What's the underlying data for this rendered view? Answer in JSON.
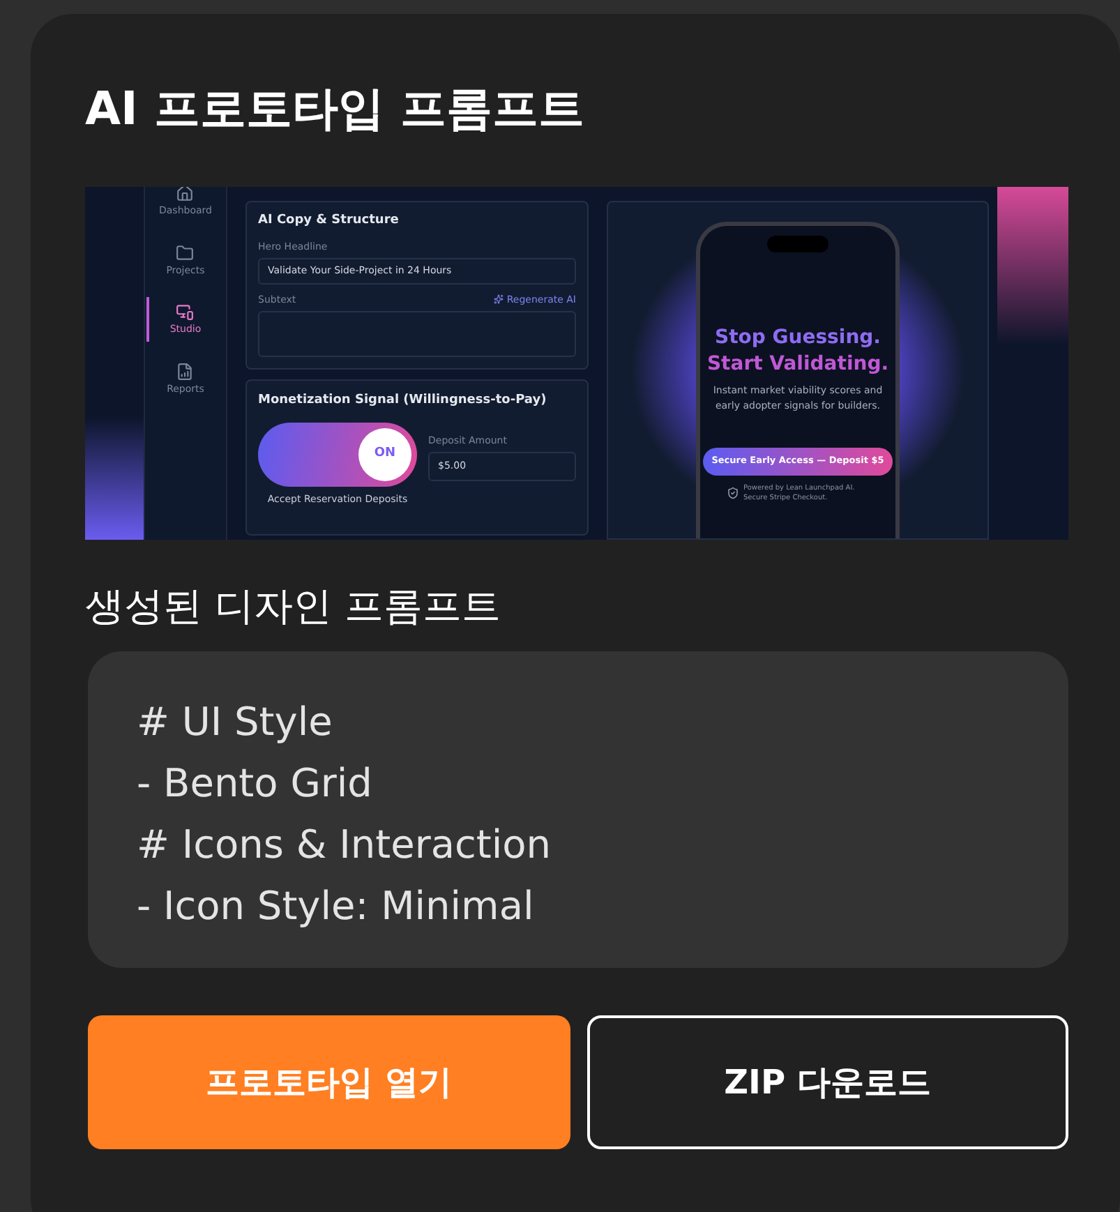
{
  "title": "AI 프로토타입 프롬프트",
  "preview": {
    "sidebar": [
      {
        "label": "Dashboard",
        "kind": "home",
        "selected": false
      },
      {
        "label": "Projects",
        "kind": "folder",
        "selected": false
      },
      {
        "label": "Studio",
        "kind": "devices",
        "selected": true
      },
      {
        "label": "Reports",
        "kind": "report",
        "selected": false
      }
    ],
    "copy_card": {
      "title": "AI Copy & Structure",
      "hero_label": "Hero Headline",
      "hero_value": "Validate Your Side-Project in 24 Hours",
      "subtext_label": "Subtext",
      "regenerate": "Regenerate AI"
    },
    "monetization": {
      "title": "Monetization Signal (Willingness-to-Pay)",
      "toggle": {
        "label": "ON",
        "on": true
      },
      "toggle_caption": "Accept Reservation Deposits",
      "deposit_label": "Deposit Amount",
      "deposit_value": "$5.00"
    },
    "phone": {
      "headline_1": "Stop Guessing.",
      "headline_2": "Start Validating.",
      "body": "Instant market viability scores and early adopter signals for builders.",
      "cta": "Secure Early Access — Deposit $5",
      "footer": "Powered by Lean Launchpad AI. Secure Stripe Checkout."
    }
  },
  "prompt_label": "생성된 디자인 프롬프트",
  "prompt_lines": [
    "# UI Style",
    "- Bento Grid",
    "# Icons & Interaction",
    "- Icon Style: Minimal"
  ],
  "buttons": [
    {
      "label": "프로토타입 열기",
      "kind": "primary"
    },
    {
      "label": "ZIP 다운로드",
      "kind": "outline"
    }
  ]
}
